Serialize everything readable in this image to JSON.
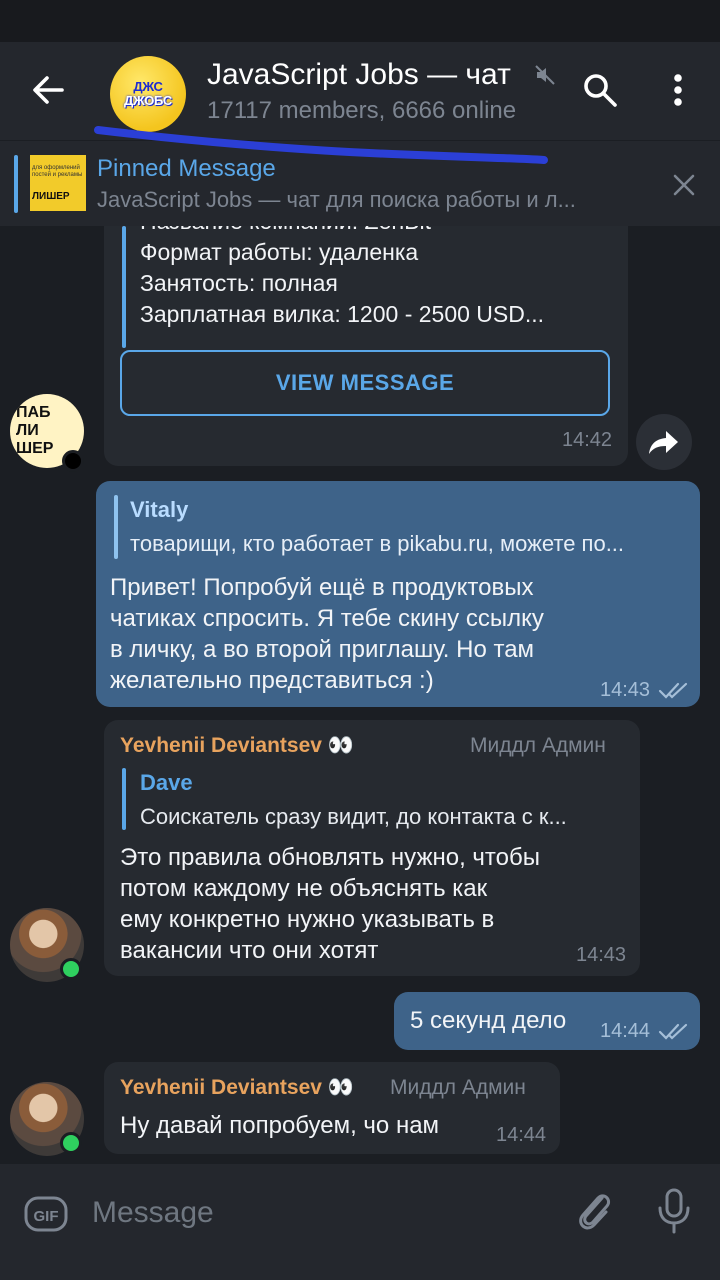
{
  "header": {
    "title": "JavaScript Jobs — чат",
    "subtitle": "17117 members, 6666 online",
    "avatar_line1": "ДЖС",
    "avatar_line2": "ДЖОБС"
  },
  "pinned": {
    "title": "Pinned Message",
    "text": "JavaScript Jobs — чат для поиска работы и л...",
    "thumb_text": "для оформлений постей и рекламы",
    "thumb_title": "ЛИШЕР"
  },
  "messages": {
    "forwarded": {
      "lines": [
        "Название компании: ZenBit",
        "Формат работы: удаленка",
        "Занятость: полная",
        "Зарплатная вилка: 1200 - 2500 USD..."
      ],
      "button": "VIEW MESSAGE",
      "time": "14:42",
      "avatar_lines": [
        "ПАБ",
        "ЛИ",
        "ШЕР"
      ]
    },
    "out1": {
      "reply_name": "Vitaly",
      "reply_text": "товарищи, кто работает в pikabu.ru, можете по...",
      "lines": [
        "Привет! Попробуй ещё в продуктовых",
        "чатиках спросить. Я тебе скину ссылку",
        "в личку, а во второй приглашу. Но там",
        "желательно представиться :)"
      ],
      "time": "14:43"
    },
    "in1": {
      "sender": "Yevhenii Deviantsev 👀",
      "role": "Миддл Админ",
      "reply_name": "Dave",
      "reply_text": "Соискатель сразу видит, до контакта с к...",
      "lines": [
        "Это правила обновлять нужно, чтобы",
        "потом каждому не объяснять как",
        "ему конкретно нужно указывать в",
        "вакансии что они хотят"
      ],
      "time": "14:43"
    },
    "out2": {
      "text": "5 секунд дело",
      "time": "14:44"
    },
    "in2": {
      "sender": "Yevhenii Deviantsev 👀",
      "role": "Миддл Админ",
      "text": "Ну давай попробуем, чо нам",
      "time": "14:44"
    }
  },
  "input": {
    "placeholder": "Message",
    "gif_label": "GIF"
  },
  "colors": {
    "accent": "#5aa7e8",
    "sender_name": "#e8a35e",
    "outgoing_bubble": "#3e6389",
    "incoming_bubble": "#262a30",
    "online": "#2fd05f",
    "scribble": "#2b3fd6"
  }
}
